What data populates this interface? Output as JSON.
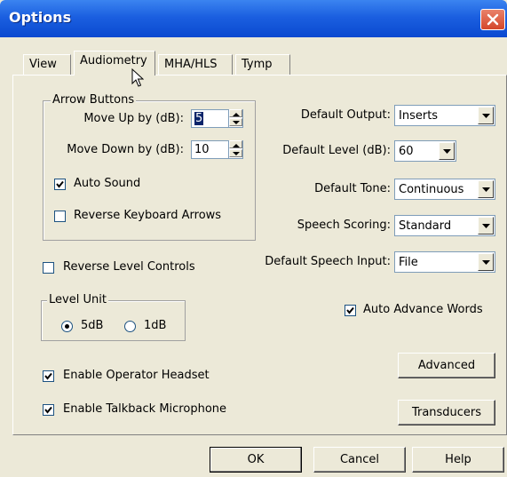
{
  "window": {
    "title": "Options"
  },
  "tabs": [
    {
      "label": "View"
    },
    {
      "label": "Audiometry"
    },
    {
      "label": "MHA/HLS"
    },
    {
      "label": "Tymp"
    }
  ],
  "arrow_buttons": {
    "legend": "Arrow Buttons",
    "move_up_label": "Move Up by (dB):",
    "move_up_value": "5",
    "move_down_label": "Move Down by (dB):",
    "move_down_value": "10",
    "auto_sound_label": "Auto Sound",
    "auto_sound_checked": true,
    "reverse_keyboard_label": "Reverse Keyboard Arrows",
    "reverse_keyboard_checked": false
  },
  "reverse_level_controls": {
    "label": "Reverse Level Controls",
    "checked": false
  },
  "level_unit": {
    "legend": "Level Unit",
    "options": [
      "5dB",
      "1dB"
    ],
    "selected": "5dB"
  },
  "enable_operator_headset": {
    "label": "Enable Operator Headset",
    "checked": true
  },
  "enable_talkback_microphone": {
    "label": "Enable Talkback Microphone",
    "checked": true
  },
  "defaults": {
    "output_label": "Default Output:",
    "output_value": "Inserts",
    "level_label": "Default Level (dB):",
    "level_value": "60",
    "tone_label": "Default Tone:",
    "tone_value": "Continuous",
    "scoring_label": "Speech Scoring:",
    "scoring_value": "Standard",
    "speech_input_label": "Default Speech Input:",
    "speech_input_value": "File"
  },
  "auto_advance_words": {
    "label": "Auto Advance Words",
    "checked": true
  },
  "buttons": {
    "advanced": "Advanced",
    "transducers": "Transducers",
    "ok": "OK",
    "cancel": "Cancel",
    "help": "Help"
  },
  "colors": {
    "titlebar": "#0a49d0",
    "dialog_bg": "#ece9d8",
    "close_button": "#d4462a",
    "selection": "#0a246a"
  }
}
